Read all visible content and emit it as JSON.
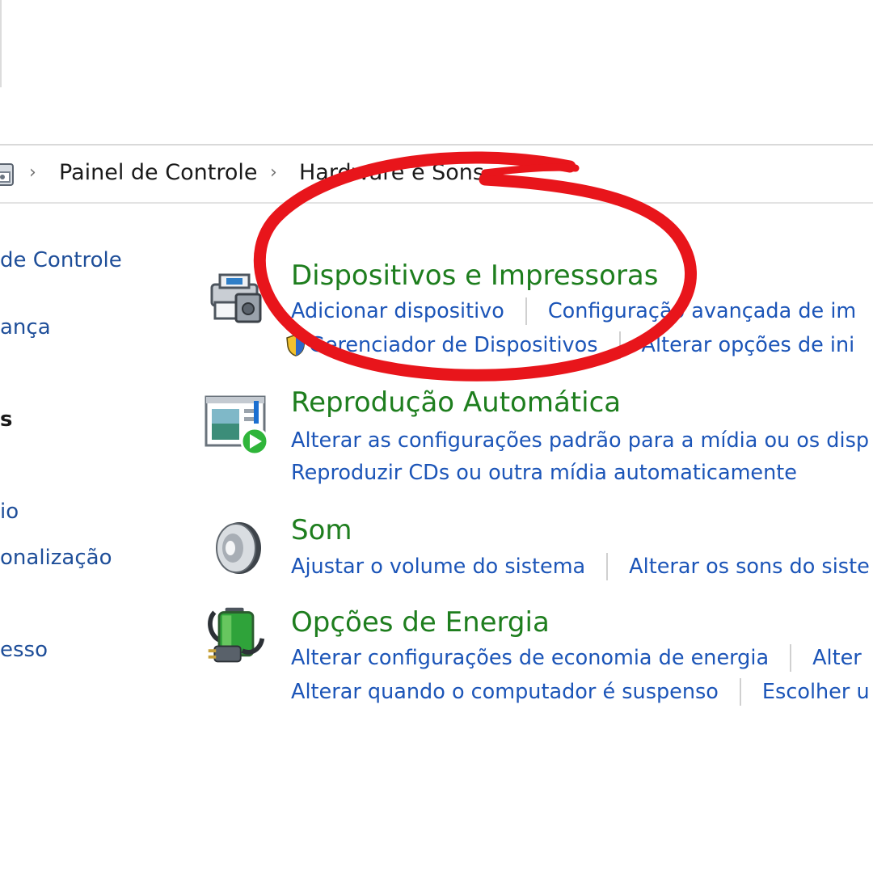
{
  "breadcrumb": {
    "items": [
      "Painel de Controle",
      "Hardware e Sons"
    ],
    "separator": "›"
  },
  "sidebar": {
    "items": [
      {
        "label": "de Controle"
      },
      {
        "label": "ança"
      },
      {
        "label": "s",
        "active": true
      },
      {
        "label": "io"
      },
      {
        "label": "onalização"
      },
      {
        "label": "esso"
      }
    ]
  },
  "categories": [
    {
      "title": "Dispositivos e Impressoras",
      "icon": "devices-printers-icon",
      "rows": [
        [
          "Adicionar dispositivo",
          "Configuração avançada de im"
        ],
        [
          "Gerenciador de Dispositivos",
          "Alterar opções de ini"
        ]
      ]
    },
    {
      "title": "Reprodução Automática",
      "icon": "autoplay-icon",
      "rows": [
        [
          "Alterar as configurações padrão para a mídia ou os disp"
        ],
        [
          "Reproduzir CDs ou outra mídia automaticamente"
        ]
      ]
    },
    {
      "title": "Som",
      "icon": "speaker-icon",
      "rows": [
        [
          "Ajustar o volume do sistema",
          "Alterar os sons do siste"
        ]
      ]
    },
    {
      "title": "Opções de Energia",
      "icon": "battery-plug-icon",
      "rows": [
        [
          "Alterar configurações de economia de energia",
          "Alter"
        ],
        [
          "Alterar quando o computador é suspenso",
          "Escolher u"
        ]
      ]
    }
  ],
  "colors": {
    "category_title": "#1e7e1e",
    "link": "#1c55b8",
    "annotation": "#e8151b"
  }
}
